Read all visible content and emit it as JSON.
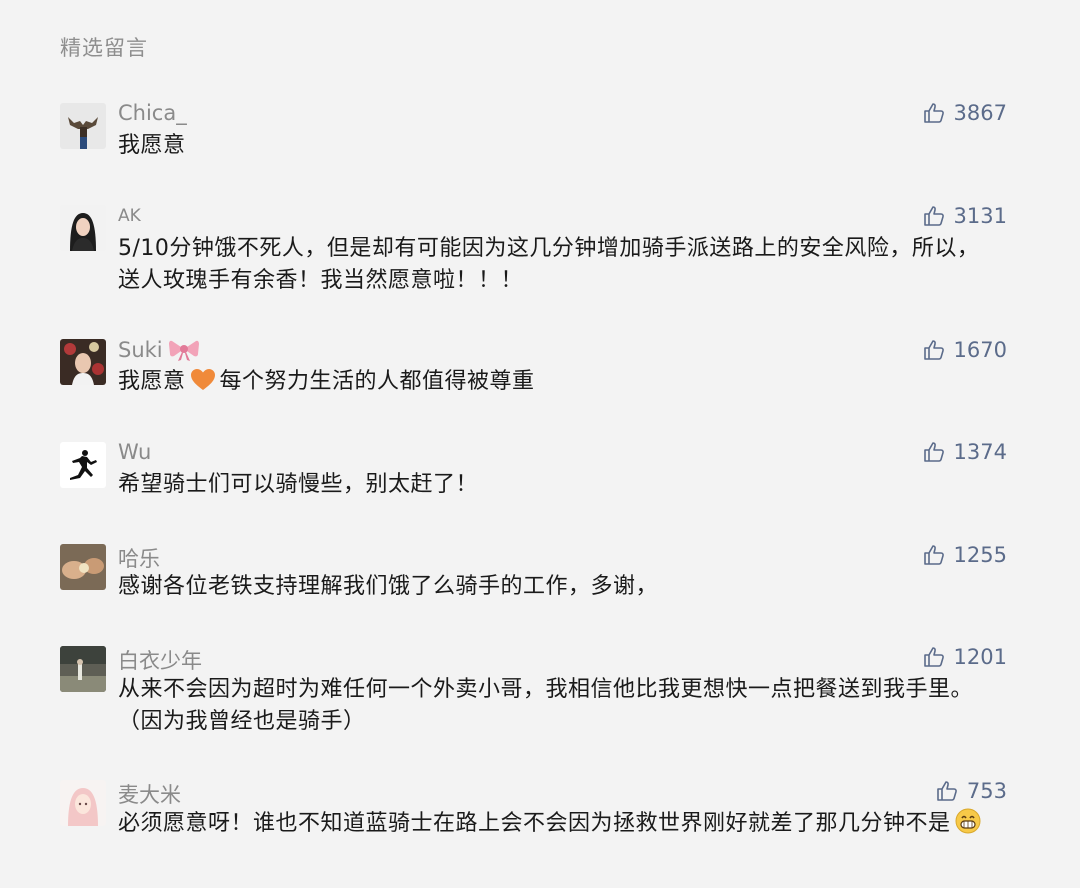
{
  "section_title": "精选留言",
  "comments": [
    {
      "nickname": "Chica_",
      "likes": "3867",
      "text": "我愿意"
    },
    {
      "nickname": "AK",
      "likes": "3131",
      "text": "5/10分钟饿不死人，但是却有可能因为这几分钟增加骑手派送路上的安全风险，所以，送人玫瑰手有余香！我当然愿意啦！！！"
    },
    {
      "nickname": "Suki",
      "nickname_emoji": "bow-emoji",
      "likes": "1670",
      "text_before": "我愿意",
      "text_emoji": "orange-heart-emoji",
      "text_after": "每个努力生活的人都值得被尊重"
    },
    {
      "nickname": "Wu",
      "likes": "1374",
      "text": "希望骑士们可以骑慢些，别太赶了！"
    },
    {
      "nickname": "哈乐",
      "likes": "1255",
      "text": "感谢各位老铁支持理解我们饿了么骑手的工作，多谢，"
    },
    {
      "nickname": "白衣少年",
      "likes": "1201",
      "text": "从来不会因为超时为难任何一个外卖小哥，我相信他比我更想快一点把餐送到我手里。（因为我曾经也是骑手）"
    },
    {
      "nickname": "麦大米",
      "likes": "753",
      "text_before": "必须愿意呀！谁也不知道蓝骑士在路上会不会因为拯救世界刚好就差了那几分钟不是",
      "text_emoji": "grinning-emoji"
    }
  ],
  "colors": {
    "background": "#f3f3f3",
    "nickname": "#8a8a8a",
    "like": "#5b6b8a",
    "text": "#1a1a1a"
  }
}
